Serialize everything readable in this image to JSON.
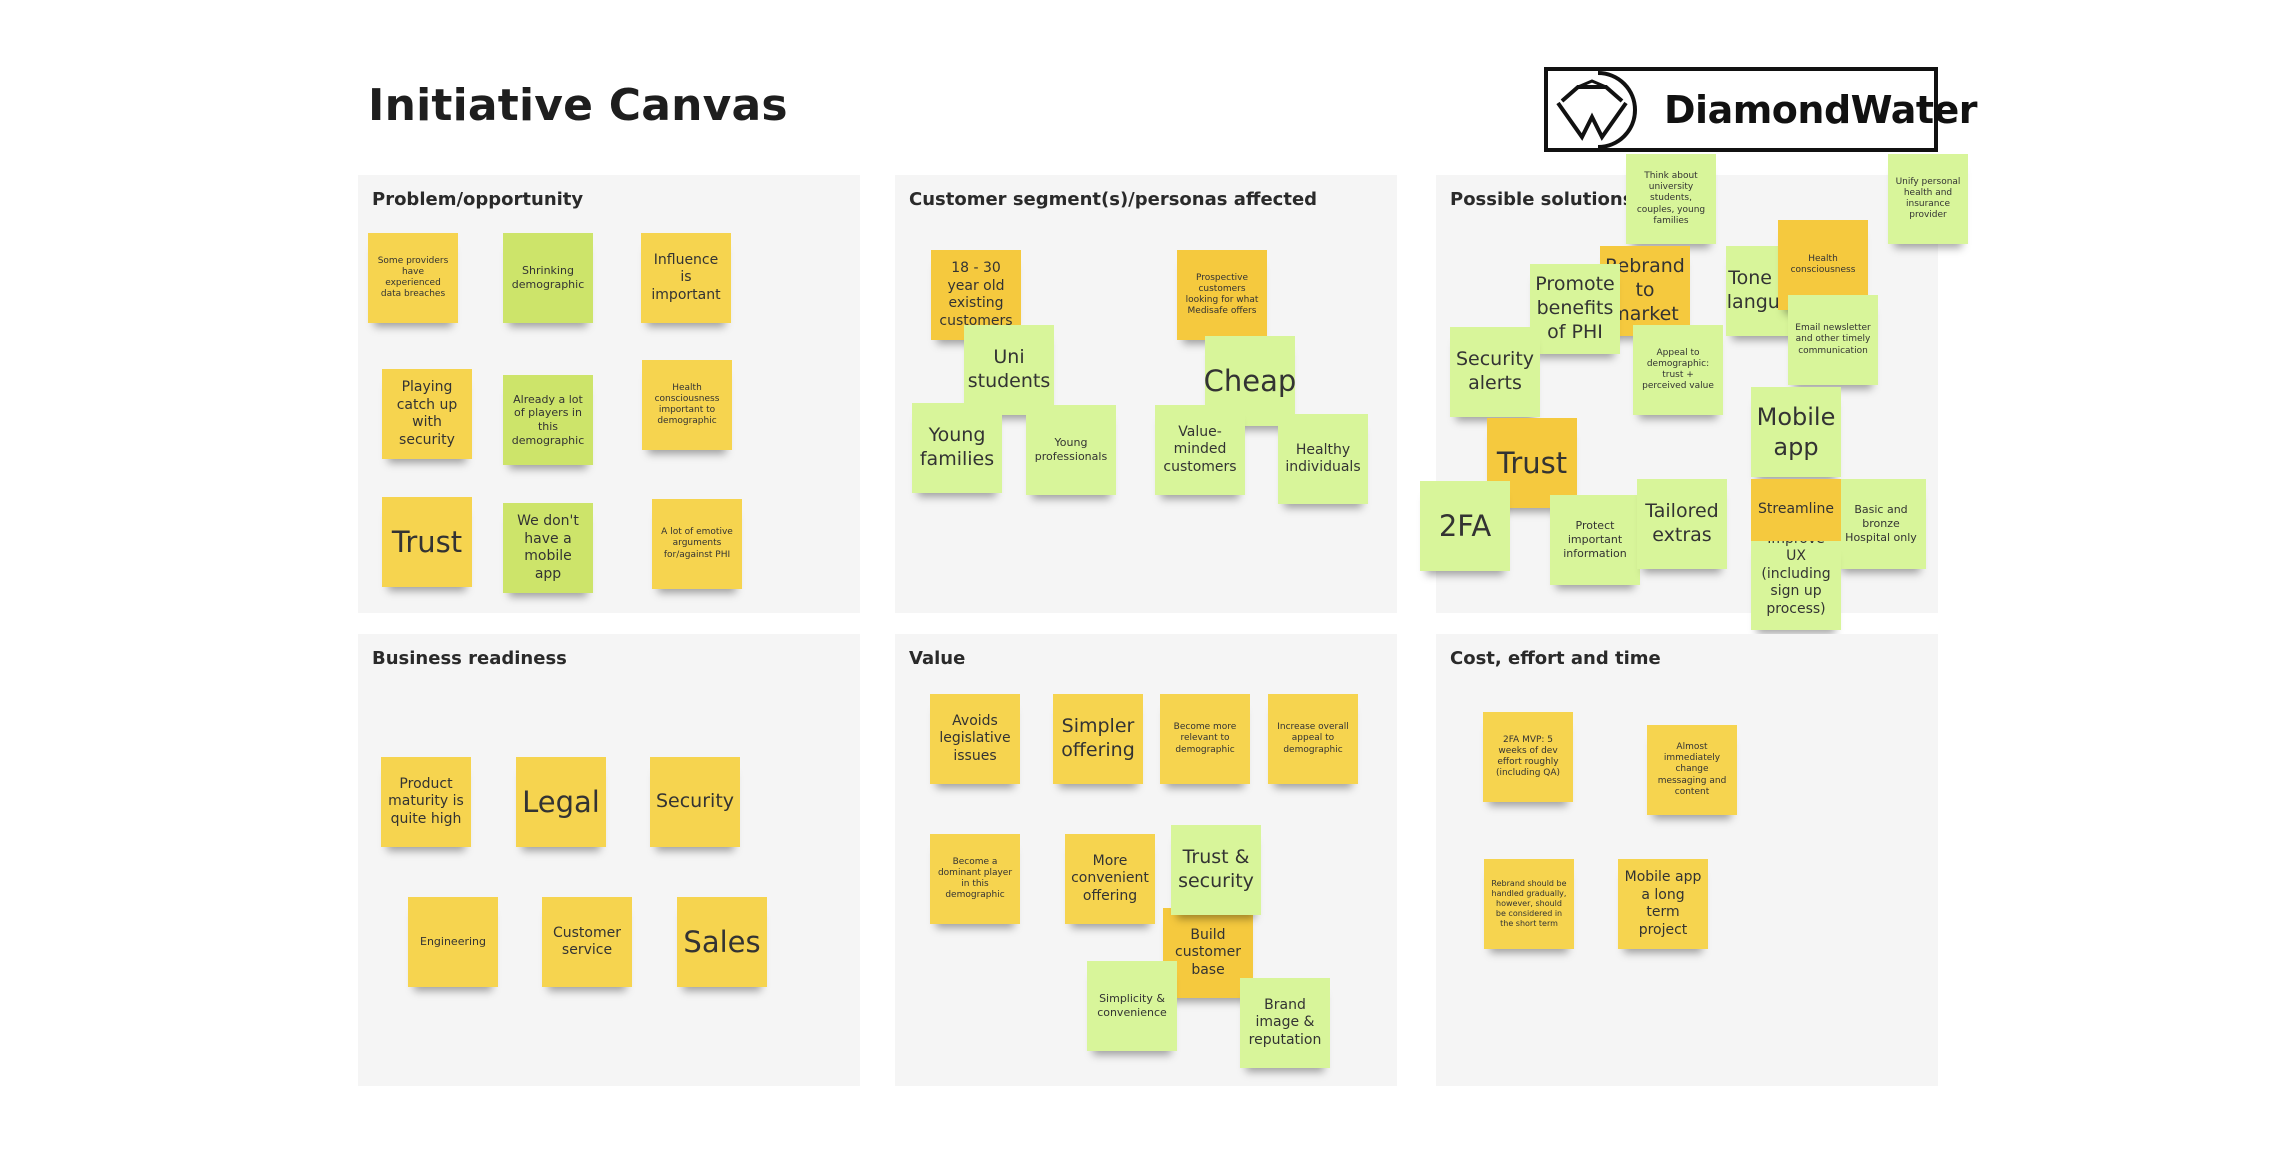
{
  "title": "Initiative Canvas",
  "logo": {
    "brand": "DiamondWater",
    "icon": "diamond-w-logo-icon"
  },
  "colors": {
    "yellow": "#f6d44f",
    "orange": "#f5c93e",
    "light_green": "#d8f59a",
    "green": "#cde46a",
    "panel_bg": "#f5f5f5"
  },
  "panels": {
    "problem": {
      "title": "Problem/opportunity",
      "notes": [
        "Some providers have experienced data breaches",
        "Shrinking demographic",
        "Influence is important",
        "Playing catch up with security",
        "Already a lot of players in this demographic",
        "Health consciousness important to demographic",
        "Trust",
        "We don't have a mobile app",
        "A lot of emotive arguments for/against PHI"
      ]
    },
    "segments": {
      "title": "Customer segment(s)/personas affected",
      "notes": [
        "18 - 30 year old existing customers",
        "Uni students",
        "Young families",
        "Young professionals",
        "Prospective customers looking for what Medisafe offers",
        "Cheap",
        "Value-minded customers",
        "Healthy individuals"
      ]
    },
    "solutions": {
      "title": "Possible solutions",
      "notes": [
        "Think about university students, couples, young families",
        "Unify personal health and insurance provider",
        "Rebrand to market",
        "Promote benefits of PHI",
        "Tone and language",
        "Health consciousness",
        "Email newsletter and other timely communication",
        "Security alerts",
        "Appeal to demographic: trust + perceived value",
        "Mobile app",
        "Trust",
        "2FA",
        "Protect important information",
        "Tailored extras",
        "Streamline",
        "Basic and bronze Hospital only",
        "Improve UX (including sign up process)"
      ]
    },
    "readiness": {
      "title": "Business readiness",
      "notes": [
        "Product maturity is quite high",
        "Legal",
        "Security",
        "Engineering",
        "Customer service",
        "Sales"
      ]
    },
    "value": {
      "title": "Value",
      "notes": [
        "Avoids legislative issues",
        "Simpler offering",
        "Become more relevant to demographic",
        "Increase overall appeal to demographic",
        "Become a dominant player in this demographic",
        "More convenient offering",
        "Trust & security",
        "Build customer base",
        "Simplicity & convenience",
        "Brand image & reputation"
      ]
    },
    "cost": {
      "title": "Cost, effort and time",
      "notes": [
        "2FA MVP: 5 weeks of dev effort roughly (including QA)",
        "Almost immediately change messaging and content",
        "Rebrand should be handled gradually, however, should be considered in the short term",
        "Mobile app a long term project"
      ]
    }
  }
}
